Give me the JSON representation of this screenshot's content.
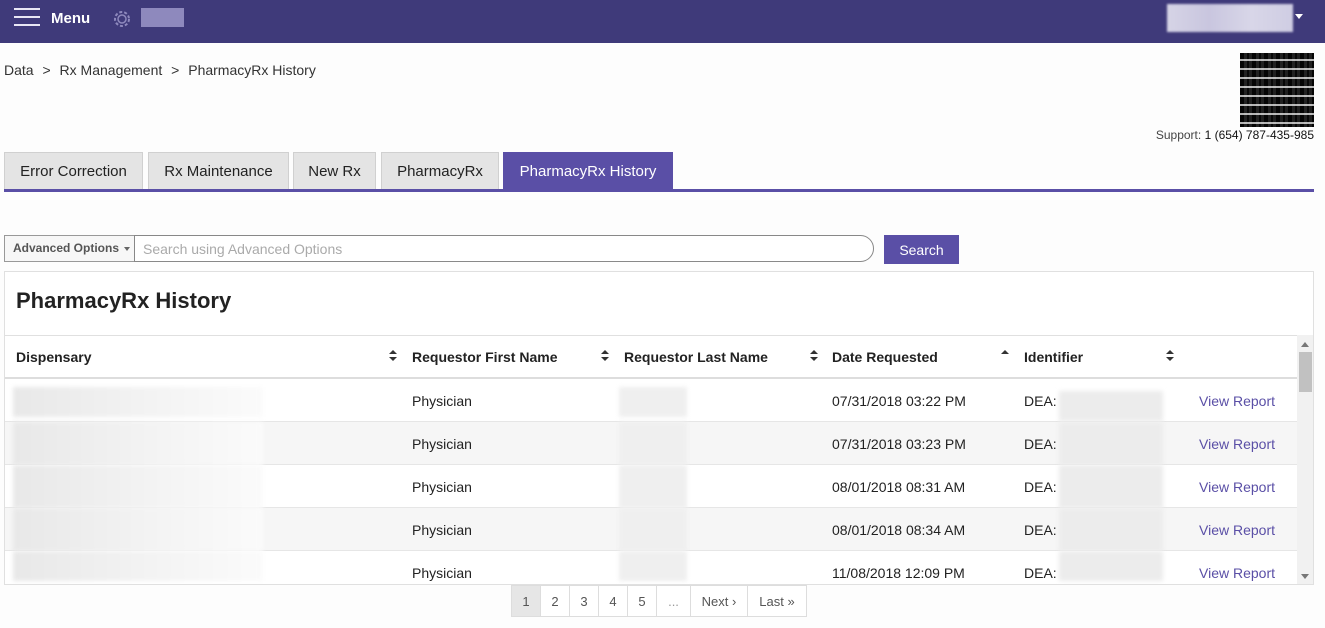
{
  "topbar": {
    "menu_label": "Menu",
    "background": "#3f3a7a"
  },
  "breadcrumb": [
    "Data",
    ">",
    "Rx Management",
    ">",
    "PharmacyRx History"
  ],
  "support": {
    "label": "Support:",
    "phone": "1 (654) 787-435-985"
  },
  "tabs": [
    {
      "label": "Error Correction",
      "active": false
    },
    {
      "label": "Rx Maintenance",
      "active": false
    },
    {
      "label": "New Rx",
      "active": false
    },
    {
      "label": "PharmacyRx",
      "active": false
    },
    {
      "label": "PharmacyRx History",
      "active": true
    }
  ],
  "search": {
    "advanced_label": "Advanced Options",
    "placeholder": "Search using Advanced Options",
    "button_label": "Search"
  },
  "panel": {
    "title": "PharmacyRx History",
    "columns": [
      "Dispensary",
      "Requestor First Name",
      "Requestor Last Name",
      "Date Requested",
      "Identifier"
    ],
    "rows": [
      {
        "first_name": "Physician",
        "date": "07/31/2018 03:22 PM",
        "identifier_prefix": "DEA:",
        "action": "View Report"
      },
      {
        "first_name": "Physician",
        "date": "07/31/2018 03:23 PM",
        "identifier_prefix": "DEA:",
        "action": "View Report"
      },
      {
        "first_name": "Physician",
        "date": "08/01/2018 08:31 AM",
        "identifier_prefix": "DEA:",
        "action": "View Report"
      },
      {
        "first_name": "Physician",
        "date": "08/01/2018 08:34 AM",
        "identifier_prefix": "DEA:",
        "action": "View Report"
      },
      {
        "first_name": "Physician",
        "date": "11/08/2018 12:09 PM",
        "identifier_prefix": "DEA:",
        "action": "View Report"
      }
    ]
  },
  "pagination": {
    "pages": [
      "1",
      "2",
      "3",
      "4",
      "5",
      "...",
      "Next ›",
      "Last »"
    ],
    "current": "1"
  },
  "colors": {
    "accent": "#5a4fa6",
    "link": "#5a4fa6"
  }
}
